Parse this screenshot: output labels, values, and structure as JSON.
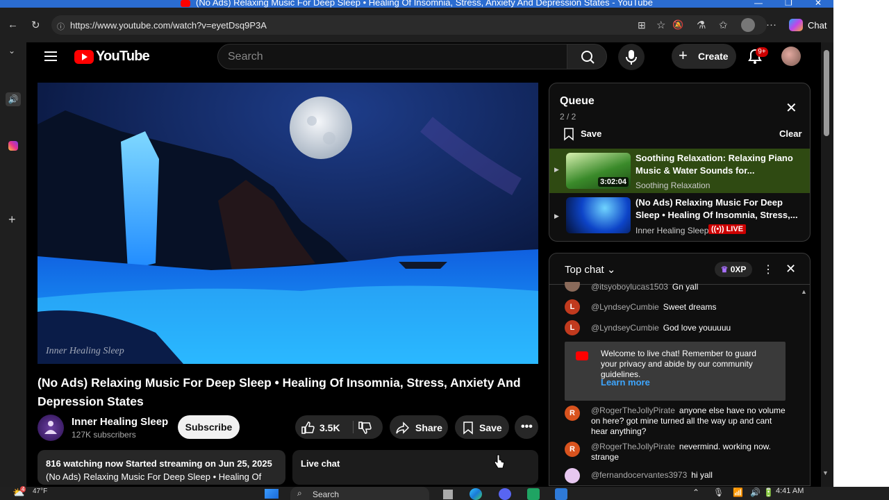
{
  "window": {
    "title": "(No Ads) Relaxing Music For Deep Sleep • Healing Of Insomnia, Stress, Anxiety And Depression States - YouTube"
  },
  "browser": {
    "url": "https://www.youtube.com/watch?v=eyetDsq9P3A",
    "chat_label": "Chat"
  },
  "youtube": {
    "logo_text": "YouTube",
    "search_placeholder": "Search",
    "create_label": "Create",
    "notification_count": "9+"
  },
  "video": {
    "watermark": "Inner Healing Sleep",
    "title": "(No Ads) Relaxing Music For Deep Sleep • Healing Of Insomnia, Stress, Anxiety And Depression States",
    "channel_name": "Inner Healing Sleep",
    "subscribers": "127K subscribers",
    "subscribe_label": "Subscribe",
    "likes": "3.5K",
    "share_label": "Share",
    "save_label": "Save",
    "description_stats": "816 watching now  Started streaming on Jun 25, 2025",
    "description_snippet": "(No Ads) Relaxing Music For Deep Sleep • Healing Of",
    "live_chat_label": "Live chat"
  },
  "queue": {
    "title": "Queue",
    "position": "2 / 2",
    "save_label": "Save",
    "clear_label": "Clear",
    "items": [
      {
        "title": "Soothing Relaxation: Relaxing Piano Music & Water Sounds for...",
        "channel": "Soothing Relaxation",
        "duration": "3:02:04"
      },
      {
        "title": "(No Ads) Relaxing Music For Deep Sleep • Healing Of Insomnia, Stress,...",
        "channel": "Inner Healing Sleep",
        "badge": "LIVE"
      }
    ]
  },
  "chat": {
    "mode_label": "Top chat",
    "xp_label": "0XP",
    "messages": [
      {
        "author": "@itsyoboylucas1503",
        "text": "Gn yall",
        "initial": ""
      },
      {
        "author": "@LyndseyCumbie",
        "text": "Sweet dreams",
        "initial": "L"
      },
      {
        "author": "@LyndseyCumbie",
        "text": "God love youuuuu",
        "initial": "L"
      }
    ],
    "welcome_text": "Welcome to live chat! Remember to guard your privacy and abide by our community guidelines.",
    "learn_more": "Learn more",
    "messages_after": [
      {
        "author": "@RogerTheJollyPirate",
        "text": "anyone else have no volume on here? got mine turned all the way up and cant hear anything?",
        "initial": "R"
      },
      {
        "author": "@RogerTheJollyPirate",
        "text": "nevermind. working now. strange",
        "initial": "R"
      },
      {
        "author": "@fernandocervantes3973",
        "text": "hi yall",
        "initial": ""
      }
    ]
  },
  "taskbar": {
    "weather": "47°F",
    "weather_badge": "4",
    "search_label": "Search",
    "time": "4:41 AM"
  },
  "colors": {
    "youtube_red": "#ff0000",
    "queue_active_bg": "#2f4a12",
    "live_badge": "#cc0000",
    "link_blue": "#3ea6ff",
    "avatar_orange": "#d9531e",
    "avatar_red": "#c13a1e"
  }
}
